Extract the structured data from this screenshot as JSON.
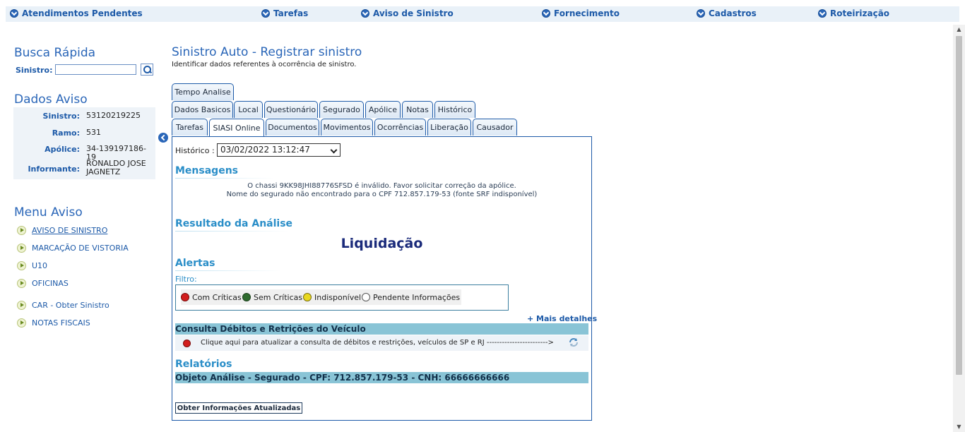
{
  "topnav": {
    "items": [
      "Atendimentos Pendentes",
      "Tarefas",
      "Aviso de Sinistro",
      "Fornecimento",
      "Cadastros",
      "Roteirização"
    ]
  },
  "sidebar": {
    "busca_title": "Busca Rápida",
    "sinistro_label": "Sinistro:",
    "sinistro_value": "",
    "dados_title": "Dados Aviso",
    "dados": [
      {
        "label": "Sinistro:",
        "value": "53120219225"
      },
      {
        "label": "Ramo:",
        "value": "531"
      },
      {
        "label": "Apólice:",
        "value": "34-139197186-19"
      },
      {
        "label": "Informante:",
        "value": "RONALDO JOSE JAGNETZ"
      }
    ],
    "menu_title": "Menu Aviso",
    "menu": [
      "AVISO DE SINISTRO",
      "MARCAÇÃO DE VISTORIA",
      "U10",
      "OFICINAS",
      "CAR - Obter Sinistro",
      "NOTAS FISCAIS"
    ]
  },
  "main": {
    "title": "Sinistro Auto - Registrar sinistro",
    "subtitle": "Identificar dados referentes à ocorrência de sinistro.",
    "tabs_row1": [
      "Tempo Analise"
    ],
    "tabs_row2": [
      "Dados Basicos",
      "Local",
      "Questionário",
      "Segurado",
      "Apólice",
      "Notas",
      "Histórico"
    ],
    "tabs_row3": [
      "Tarefas",
      "SIASI Online",
      "Documentos",
      "Movimentos",
      "Ocorrências",
      "Liberação",
      "Causador"
    ],
    "active_tab": "SIASI Online",
    "historico_label": "Histórico :",
    "historico_value": "03/02/2022 13:12:47",
    "mensagens_title": "Mensagens",
    "mensagens": [
      "O chassi 9KK98JHI88776SFSD é inválido. Favor solicitar correção da apólice.",
      "Nome do segurado não encontrado para o CPF 712.857.179-53 (fonte SRF indisponível)"
    ],
    "resultado_title": "Resultado da Análise",
    "resultado_value": "Liquidação",
    "alertas_title": "Alertas",
    "filtro_label": "Filtro:",
    "filtros": [
      {
        "label": "Com Críticas",
        "color": "#d21e1e"
      },
      {
        "label": "Sem Críticas",
        "color": "#2e6b2e"
      },
      {
        "label": "Indisponível",
        "color": "#e8d820"
      },
      {
        "label": "Pendente Informações",
        "color": "#ffffff"
      }
    ],
    "mais_detalhes": "+ Mais detalhes",
    "consulta_title": "Consulta Débitos e Retrições do Veículo",
    "consulta_text": "Clique aqui para atualizar a consulta de débitos e restrições, veículos de SP e RJ ------------------------>",
    "relatorios_title": "Relatórios",
    "objeto_analise": "Objeto Análise - Segurado - CPF: 712.857.179-53 - CNH: 66666666666",
    "obter_button": "Obter Informações Atualizadas"
  }
}
